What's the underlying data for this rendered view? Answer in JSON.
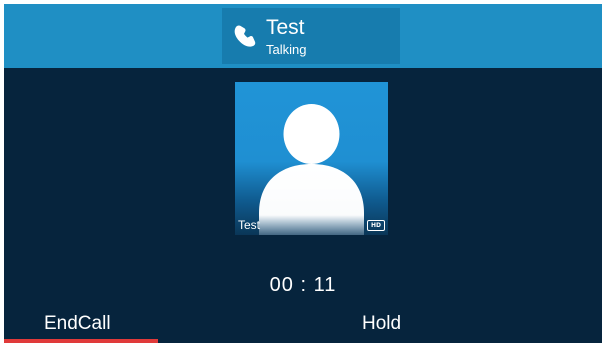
{
  "call": {
    "name": "Test",
    "status": "Talking",
    "icon": "phone-icon"
  },
  "contact_card": {
    "label": "Test",
    "badge": "HD",
    "icon": "contact-avatar-icon"
  },
  "timer": "00 : 11",
  "softkeys": {
    "end_call": "EndCall",
    "hold": "Hold"
  },
  "colors": {
    "top_bar": "#1f8fc4",
    "header_highlight": "#177cae",
    "background": "#06243d",
    "selected_key_indicator": "#e03a3a"
  }
}
